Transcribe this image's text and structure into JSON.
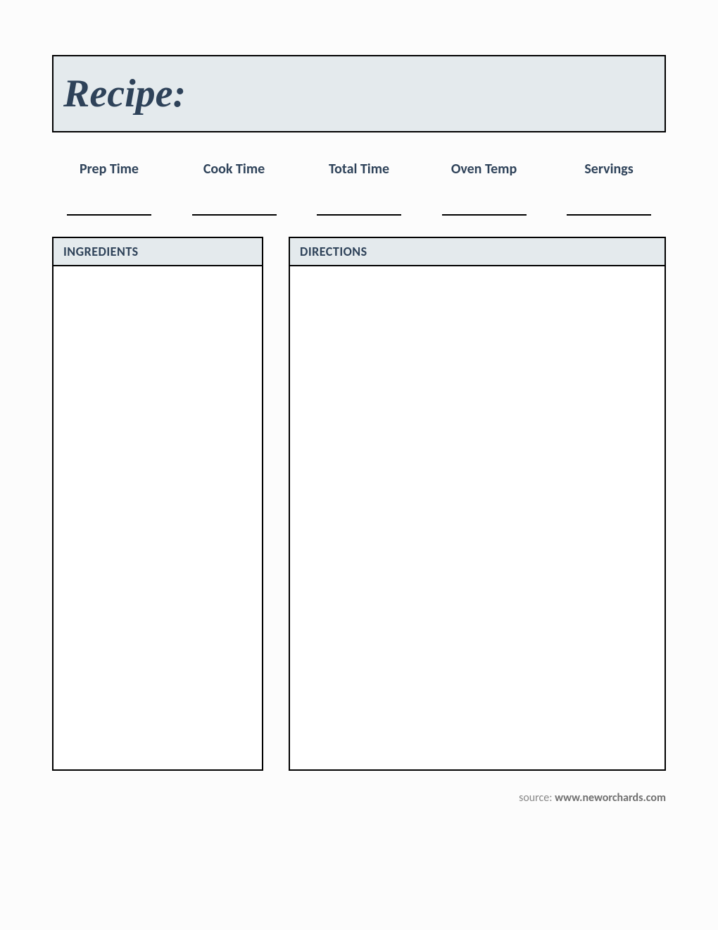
{
  "header": {
    "title": "Recipe:"
  },
  "meta": {
    "prep_time_label": "Prep Time",
    "cook_time_label": "Cook Time",
    "total_time_label": "Total Time",
    "oven_temp_label": "Oven Temp",
    "servings_label": "Servings"
  },
  "sections": {
    "ingredients_label": "INGREDIENTS",
    "directions_label": "DIRECTIONS"
  },
  "footer": {
    "source_prefix": "source: ",
    "source_url": "www.neworchards.com"
  }
}
